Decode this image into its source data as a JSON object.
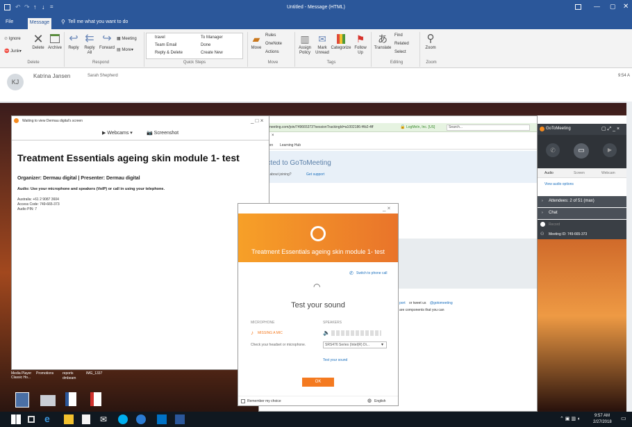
{
  "outlook": {
    "title": "Untitled - Message (HTML)",
    "tabs": [
      "File",
      "Message"
    ],
    "tell_me": "Tell me what you want to do",
    "delete": {
      "ignore": "Ignore",
      "junk": "Junk",
      "delete": "Delete",
      "archive": "Archive",
      "group": "Delete"
    },
    "respond": {
      "reply": "Reply",
      "reply_all": "Reply All",
      "forward": "Forward",
      "meeting": "Meeting",
      "more": "More",
      "group": "Respond"
    },
    "quicksteps": {
      "items": [
        "travel",
        "Team Email",
        "Reply & Delete",
        "To Manager",
        "Done",
        "Create New"
      ],
      "group": "Quick Steps"
    },
    "move": {
      "move": "Move",
      "rules": "Rules",
      "onenote": "OneNote",
      "actions": "Actions",
      "group": "Move"
    },
    "tags": {
      "assign": "Assign Policy",
      "mark": "Mark Unread",
      "categorize": "Categorize",
      "follow": "Follow Up",
      "group": "Tags"
    },
    "editing": {
      "translate": "Translate",
      "find": "Find",
      "related": "Related",
      "select": "Select",
      "group": "Editing"
    },
    "zoom": {
      "label": "Zoom",
      "group": "Zoom"
    },
    "sender": "Katrina Jansen",
    "avatar": "KJ",
    "recipient": "Sarah Shepherd",
    "time": "9:54 A"
  },
  "viewer": {
    "status": "Waiting to view Dermau digital's screen",
    "webcams": "Webcams",
    "screenshot": "Screenshot",
    "title": "Treatment Essentials ageing skin module 1- test",
    "organizer": "Organizer: Dermau digital | Presenter: Dermau digital",
    "audio": "Audio: Use your microphone and speakers (VoIP) or call in using your telephone.",
    "lines": [
      "Australia: +61 2 9087 3604",
      "Access Code: 749-665-373",
      "Audio PIN: 7"
    ],
    "win_ctrl": "_ □ ×"
  },
  "browser": {
    "address": "gotomeeting.com/join/749665373?sessionTrackingId=a1002186-f4b2-4ff",
    "cert": "LogMeIn, Inc. [US]",
    "search": "Search...",
    "fav1": "ucation",
    "fav2": "Learning Hub",
    "connected": "ected to GoToMeeting",
    "question": "ons about joining?",
    "support": "Get support",
    "support2": "port",
    "tweet": "or tweet us",
    "handle": "@gotomeeting",
    "comp": "are components that you can"
  },
  "dialog": {
    "title": "Treatment Essentials ageing skin module 1- test",
    "switch": "Switch to phone call",
    "heading": "Test your sound",
    "mic_label": "MICROPHONE",
    "spk_label": "SPEAKERS",
    "mic_status": "MISSING A MIC",
    "mic_hint": "Check your headset or microphone.",
    "speaker_select": "SRS476 Series (Intel(R) Di...",
    "test": "Test your sound",
    "ok": "OK",
    "remember": "Remember my choice",
    "lang": "English"
  },
  "panel": {
    "logo": "GoToMeeting",
    "tabs": [
      "Audio",
      "Screen",
      "Webcam"
    ],
    "options": "View audio options",
    "attendees": "Attendees: 2 of 51 (max)",
    "chat": "Chat",
    "record": "Record",
    "meeting_id": "Meeting ID: 749-665-373"
  },
  "desktop": {
    "icons": [
      "Media Player Classic Ho...",
      "Promotions",
      "reports",
      "IMG_1337"
    ],
    "sub": "dmbeam"
  },
  "taskbar": {
    "time": "9:57 AM",
    "date": "2/27/2018"
  },
  "colors": {
    "outlook_blue": "#2b579a",
    "gtm_orange": "#f68b1f",
    "ok_orange": "#f47a20",
    "panel_dark": "#3a3f45"
  }
}
